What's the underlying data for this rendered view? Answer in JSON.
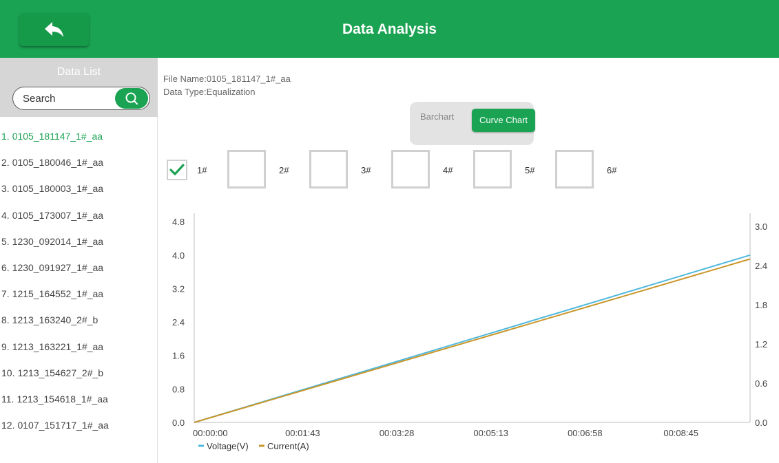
{
  "header": {
    "title": "Data Analysis",
    "back_icon": "back-arrow-icon"
  },
  "sidebar": {
    "title": "Data List",
    "search_placeholder": "Search",
    "search_icon": "search-icon",
    "items": [
      {
        "index": "1.",
        "name": "0105_181147_1#_aa",
        "active": true
      },
      {
        "index": "2.",
        "name": "0105_180046_1#_aa"
      },
      {
        "index": "3.",
        "name": "0105_180003_1#_aa"
      },
      {
        "index": "4.",
        "name": "0105_173007_1#_aa"
      },
      {
        "index": "5.",
        "name": "1230_092014_1#_aa"
      },
      {
        "index": "6.",
        "name": "1230_091927_1#_aa"
      },
      {
        "index": "7.",
        "name": "1215_164552_1#_aa"
      },
      {
        "index": "8.",
        "name": "1213_163240_2#_b"
      },
      {
        "index": "9.",
        "name": "1213_163221_1#_aa"
      },
      {
        "index": "10.",
        "name": "1213_154627_2#_b"
      },
      {
        "index": "11.",
        "name": "1213_154618_1#_aa"
      },
      {
        "index": "12.",
        "name": "0107_151717_1#_aa"
      }
    ]
  },
  "info": {
    "file_name": "File Name:0105_181147_1#_aa",
    "data_type": "Data Type:Equalization"
  },
  "toggle": {
    "barchart": "Barchart",
    "curve": "Curve Chart",
    "selected": "Curve Chart"
  },
  "channels": [
    {
      "label": "1#",
      "checked": true
    },
    {
      "label": "2#",
      "checked": false
    },
    {
      "label": "3#",
      "checked": false
    },
    {
      "label": "4#",
      "checked": false
    },
    {
      "label": "5#",
      "checked": false
    },
    {
      "label": "6#",
      "checked": false
    }
  ],
  "colors": {
    "accent": "#1aa352",
    "voltage": "#4fb8dc",
    "current": "#c8962a"
  },
  "chart_data": {
    "type": "line",
    "x": [
      "00:00:00",
      "00:01:43",
      "00:03:28",
      "00:05:13",
      "00:06:58",
      "00:08:45"
    ],
    "left_axis_ticks": [
      "0.0",
      "0.8",
      "1.6",
      "2.4",
      "3.2",
      "4.0",
      "4.8"
    ],
    "right_axis_ticks": [
      "0.0",
      "0.6",
      "1.2",
      "1.8",
      "2.4",
      "3.0"
    ],
    "ylim_left": [
      0,
      5.0
    ],
    "ylim_right": [
      0,
      3.2
    ],
    "series": [
      {
        "name": "Voltage(V)",
        "axis": "left",
        "start": [
          0,
          0.0
        ],
        "end": [
          620,
          4.0
        ]
      },
      {
        "name": "Current(A)",
        "axis": "right",
        "start": [
          0,
          0.0
        ],
        "end": [
          620,
          2.5
        ]
      }
    ],
    "x_range_seconds": [
      0,
      620
    ],
    "x_tick_seconds": [
      0,
      103,
      208,
      313,
      418,
      525
    ],
    "legend": "bottom-left"
  }
}
